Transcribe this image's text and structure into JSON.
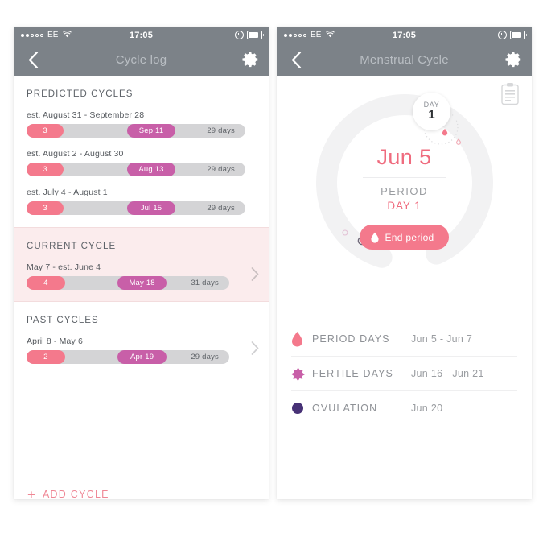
{
  "statusbar": {
    "carrier": "EE",
    "time": "17:05",
    "signal_dots_filled": 2,
    "signal_dots_total": 5,
    "wifi_icon": "wifi-icon",
    "alarm_icon": "alarm-icon",
    "battery_icon": "battery-icon"
  },
  "left_screen": {
    "nav": {
      "back_icon": "chevron-left-icon",
      "title": "Cycle log",
      "settings_icon": "gear-icon"
    },
    "sections": [
      {
        "id": "predicted",
        "heading": "PREDICTED CYCLES",
        "highlighted": false,
        "rows": [
          {
            "date_range": "est. August 31 - September 28",
            "period_days": "3",
            "ovulation_label": "Sep 11",
            "length_label": "29 days",
            "has_chevron": false,
            "period_pct": 17,
            "ov_left_pct": 46,
            "ov_width_pct": 22
          },
          {
            "date_range": "est. August 2 - August 30",
            "period_days": "3",
            "ovulation_label": "Aug 13",
            "length_label": "29 days",
            "has_chevron": false,
            "period_pct": 17,
            "ov_left_pct": 46,
            "ov_width_pct": 22
          },
          {
            "date_range": "est. July 4 - August 1",
            "period_days": "3",
            "ovulation_label": "Jul 15",
            "length_label": "29 days",
            "has_chevron": false,
            "period_pct": 17,
            "ov_left_pct": 46,
            "ov_width_pct": 22
          }
        ]
      },
      {
        "id": "current",
        "heading": "CURRENT CYCLE",
        "highlighted": true,
        "rows": [
          {
            "date_range": "May 7 - est. June 4",
            "period_days": "4",
            "ovulation_label": "May 18",
            "length_label": "31 days",
            "has_chevron": true,
            "period_pct": 19,
            "ov_left_pct": 45,
            "ov_width_pct": 24
          }
        ]
      },
      {
        "id": "past",
        "heading": "PAST CYCLES",
        "highlighted": false,
        "rows": [
          {
            "date_range": "April 8 - May 6",
            "period_days": "2",
            "ovulation_label": "Apr 19",
            "length_label": "29 days",
            "has_chevron": true,
            "period_pct": 19,
            "ov_left_pct": 45,
            "ov_width_pct": 24
          }
        ]
      }
    ],
    "add_cycle": {
      "plus_icon": "plus-icon",
      "label": "ADD CYCLE"
    }
  },
  "right_screen": {
    "nav": {
      "back_icon": "chevron-left-icon",
      "title": "Menstrual Cycle",
      "settings_icon": "gear-icon"
    },
    "notes_icon": "clipboard-icon",
    "dial": {
      "day_badge_word": "DAY",
      "day_badge_number": "1",
      "current_date": "Jun 5",
      "phase_label": "PERIOD",
      "phase_day": "DAY 1",
      "action_button_label": "End period",
      "action_button_icon": "drop-icon",
      "track_color": "#f2f2f3"
    },
    "legend": [
      {
        "icon": "drop-icon",
        "icon_color": "#f4798c",
        "label": "PERIOD DAYS",
        "value": "Jun 5 - Jun 7"
      },
      {
        "icon": "flower-icon",
        "icon_color": "#c85fa8",
        "label": "FERTILE DAYS",
        "value": "Jun 16 - Jun 21"
      },
      {
        "icon": "circle-icon",
        "icon_color": "#473176",
        "label": "OVULATION",
        "value": "Jun 20"
      }
    ]
  },
  "colors": {
    "navbar": "#7c8288",
    "period": "#f4798c",
    "ovulation": "#c85fa8",
    "accent_text": "#ef6b7e",
    "current_bg": "#fbeced",
    "track": "#d4d4d6"
  }
}
